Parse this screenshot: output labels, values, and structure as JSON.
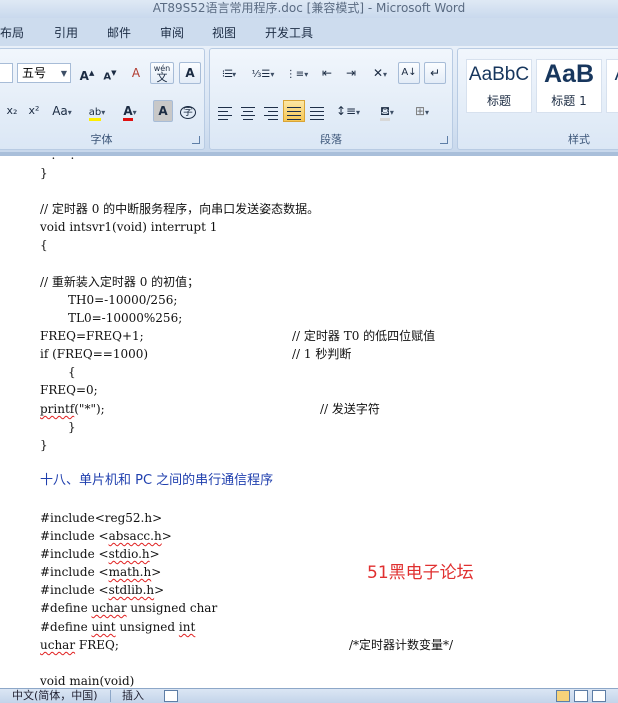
{
  "window": {
    "title": "AT89S52语言常用程序.doc [兼容模式] - Microsoft Word"
  },
  "tabs": [
    "布局",
    "引用",
    "邮件",
    "审阅",
    "视图",
    "开发工具"
  ],
  "ribbon": {
    "font_group": {
      "label": "字体",
      "size_value": "五号",
      "grow_label": "A",
      "shrink_label": "A",
      "clear_label": "A",
      "subscript_label": "x₂",
      "superscript_label": "x²",
      "case_label": "Aa",
      "highlight_label": "ab",
      "font_color_label": "A",
      "char_shade_label": "A",
      "enclose_label": "字",
      "phonetic_label": "wén"
    },
    "paragraph_group": {
      "label": "段落"
    },
    "styles_group": {
      "label": "样式",
      "styles": [
        {
          "sample": "AaBbC",
          "name": "标题"
        },
        {
          "sample": "AaB",
          "name": "标题 1"
        }
      ]
    }
  },
  "document": {
    "brace_close": "}",
    "comment_isr": "// 定时器 0 的中断服务程序，向串口发送姿态数据。",
    "isr_sig": "void intsvr1(void) interrupt 1",
    "brace_open": "{",
    "comment_reload": "// 重新装入定时器 0 的初值；",
    "th0": "TH0=-10000/256;",
    "tl0": "TL0=-10000%256;",
    "freq_inc": "FREQ=FREQ+1;",
    "freq_inc_comment": "// 定时器 T0 的低四位赋值",
    "if_line": "if (FREQ==1000)",
    "if_comment": "// 1 秒判断",
    "inner_open": "{",
    "freq_reset": "FREQ=0;",
    "printf_fn": "printf",
    "printf_args": "(\"*\");",
    "printf_comment": "// 发送字符",
    "inner_close": "}",
    "outer_close": "}",
    "section_heading": "十八、单片机和 PC 之间的串行通信程序",
    "inc_reg52": "#include<reg52.h>",
    "inc_prefix": "#include <",
    "inc_suffix": ">",
    "inc_absacc": "absacc.h",
    "inc_stdio": "stdio.h",
    "inc_math": "math.h",
    "inc_stdlib": "stdlib.h",
    "def_prefix": "#define ",
    "uchar": "uchar",
    "def_uchar_rest": " unsigned char",
    "uint": "uint",
    "def_uint_rest": " unsigned ",
    "int_kw": "int",
    "freq_decl_rest": " FREQ;",
    "freq_decl_comment": "/*定时器计数变量*/",
    "main_sig": "void main(void)",
    "watermark": "51黑电子论坛"
  },
  "statusbar": {
    "language": "中文(简体，中国)",
    "insert_mode": "插入"
  }
}
